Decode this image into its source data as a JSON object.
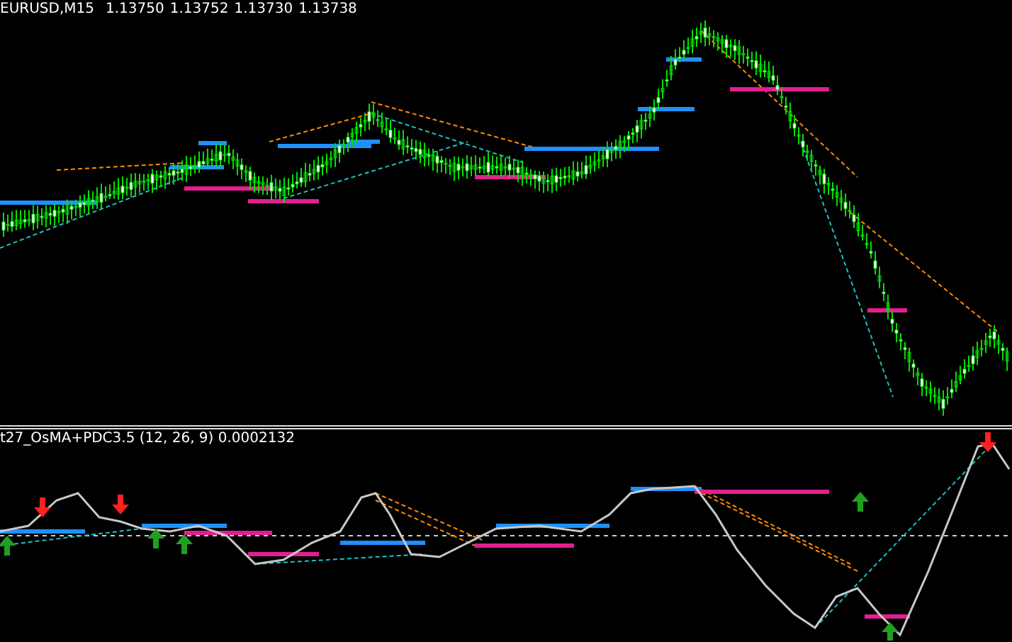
{
  "main_chart": {
    "symbol": "EURUSD,M15",
    "open": "1.13750",
    "high": "1.13752",
    "low": "1.13730",
    "close": "1.13738"
  },
  "indicator": {
    "title": "t27_OsMA+PDC3.5 (12, 26, 9) 0.0002132"
  }
}
